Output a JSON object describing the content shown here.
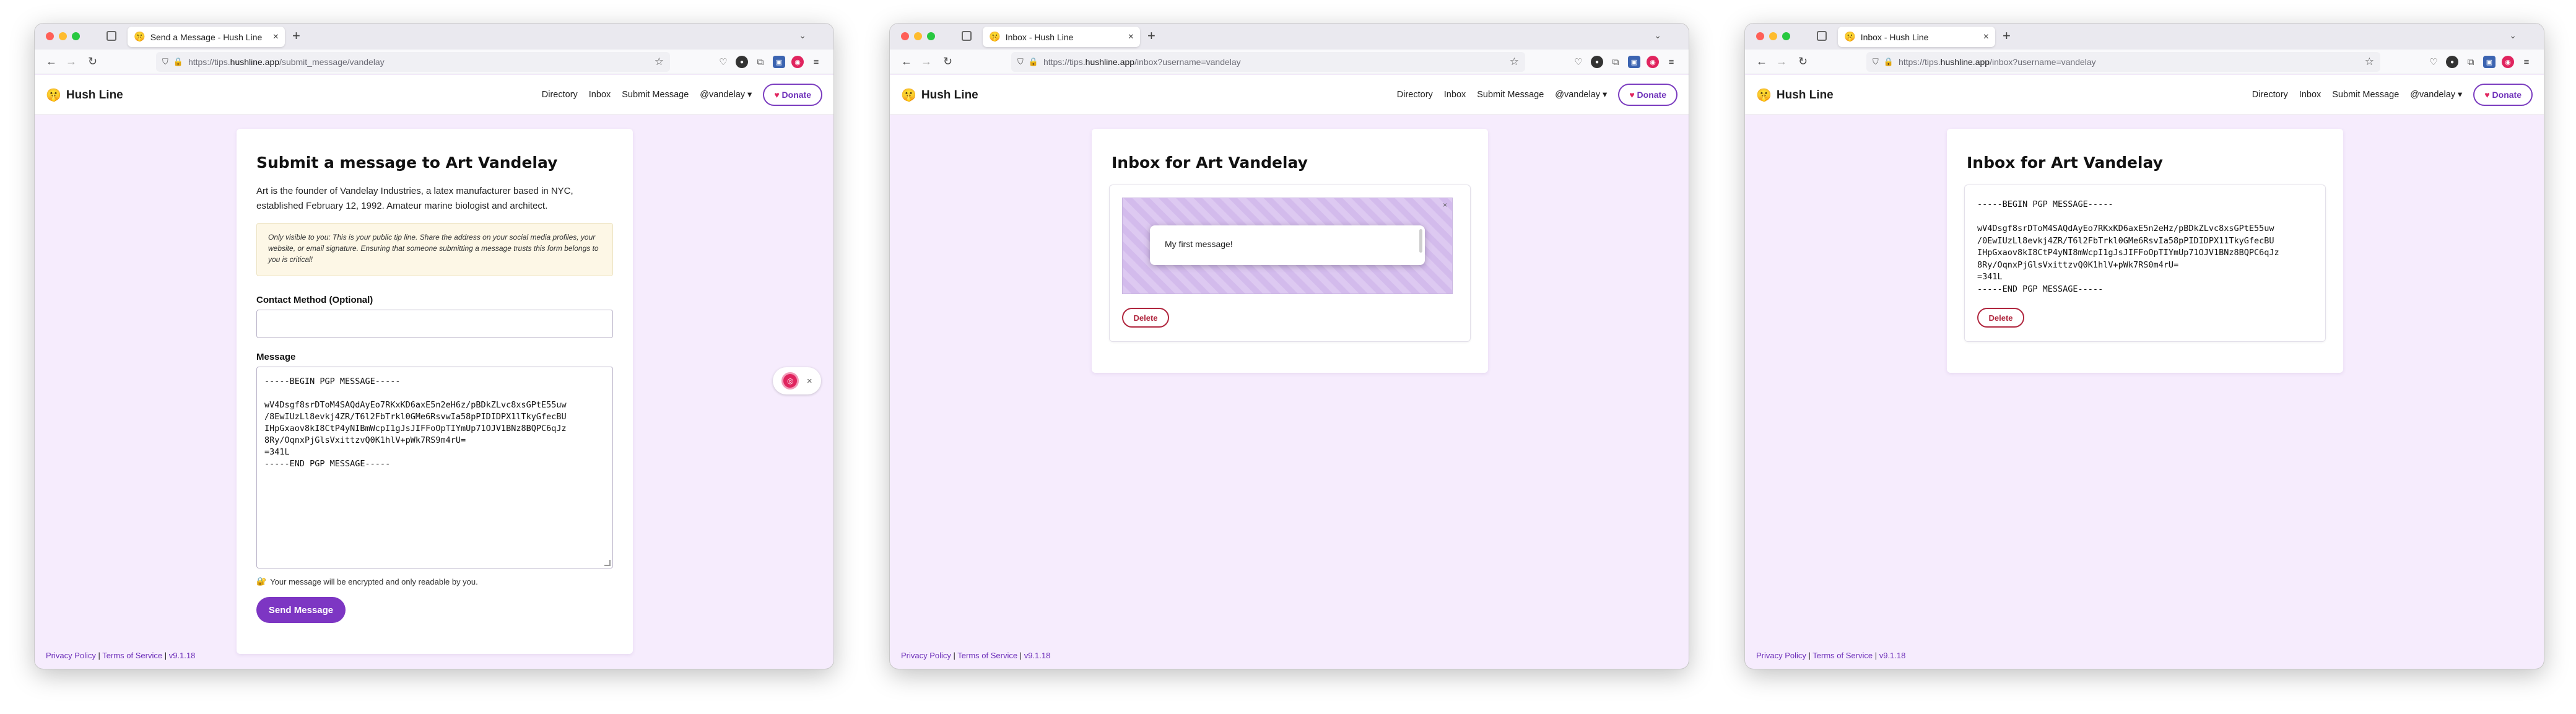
{
  "windows": [
    {
      "tab_title": "Send a Message - Hush Line",
      "url_prefix": "https://tips.",
      "url_host": "hushline.app",
      "url_path": "/submit_message/vandelay"
    },
    {
      "tab_title": "Inbox - Hush Line",
      "url_prefix": "https://tips.",
      "url_host": "hushline.app",
      "url_path": "/inbox?username=vandelay"
    },
    {
      "tab_title": "Inbox - Hush Line",
      "url_prefix": "https://tips.",
      "url_host": "hushline.app",
      "url_path": "/inbox?username=vandelay"
    }
  ],
  "site": {
    "logo_text": "Hush Line",
    "logo_emoji": "🤫",
    "nav": {
      "directory": "Directory",
      "inbox": "Inbox",
      "submit": "Submit Message",
      "user": "@vandelay ▾",
      "donate": "Donate"
    },
    "footer": {
      "privacy": "Privacy Policy",
      "sep": " | ",
      "terms": "Terms of Service",
      "version": "v9.1.18"
    }
  },
  "submit": {
    "title": "Submit a message to Art Vandelay",
    "bio": "Art is the founder of Vandelay Industries, a latex manufacturer based in NYC, established February 12, 1992. Amateur marine biologist and architect.",
    "notice": "Only visible to you: This is your public tip line. Share the address on your social media profiles, your website, or email signature. Ensuring that someone submitting a message trusts this form belongs to you is critical!",
    "contact_label": "Contact Method (Optional)",
    "message_label": "Message",
    "message_value": "-----BEGIN PGP MESSAGE-----\n\nwV4Dsgf8srDToM4SAQdAyEo7RKxKD6axE5n2eH6z/pBDkZLvc8xsGPtE55uw\n/8EwIUzLl8evkj4ZR/T6l2FbTrkl0GMe6RsvwIa58pPIDIDPX1lTkyGfecBU\nIHpGxaov8kI8CtP4yNIBmWcpI1gJsJIFFoOpTIYmUp71OJV1BNz8BQPC6qJz\n8Ry/OqnxPjGlsVxittzvQ0K1hlV+pWk7RS9m4rU=\n=341L\n-----END PGP MESSAGE-----",
    "enc_note_icon": "🔐",
    "enc_note": "Your message will be encrypted and only readable by you.",
    "send_label": "Send Message",
    "ext_x": "×"
  },
  "inbox": {
    "title": "Inbox for Art Vandelay",
    "bubble_text": "My first message!",
    "delete_label": "Delete",
    "pgp_text": "-----BEGIN PGP MESSAGE-----\n\nwV4Dsgf8srDToM4SAQdAyEo7RKxKD6axE5n2eHz/pBDkZLvc8xsGPtE55uw\n/0EwIUzLl8evkj4ZR/T6l2FbTrkl0GMe6RsvIa58pPIDIDPX11TkyGfecBU\nIHpGxaov8kI8CtP4yNI8mWcpI1gJsJIFFoOpTIYmUp71OJV1BNz8BQPC6qJz\n8Ry/OqnxPjGlsVxittzvQ0K1hlV+pWk7RS0m4rU=\n=341L\n-----END PGP MESSAGE-----"
  }
}
